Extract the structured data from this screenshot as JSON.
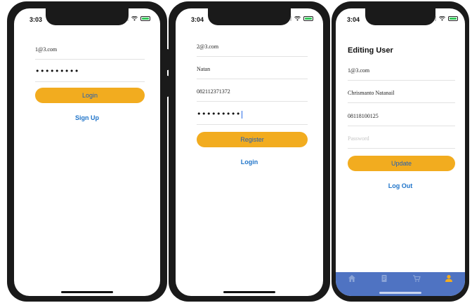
{
  "login_screen": {
    "status": {
      "time": "3:03"
    },
    "email_value": "1@3.com",
    "password_mask": "•••••••••",
    "login_button": "Login",
    "signup_link": "Sign Up"
  },
  "register_screen": {
    "status": {
      "time": "3:04"
    },
    "email_value": "2@3.com",
    "name_value": "Natan",
    "phone_value": "082112371372",
    "password_mask": "•••••••••",
    "register_button": "Register",
    "login_link": "Login"
  },
  "edit_screen": {
    "status": {
      "time": "3:04"
    },
    "title": "Editing User",
    "email_value": "1@3.com",
    "name_value": "Chrismanto Natanail",
    "phone_value": "08118100125",
    "password_placeholder": "Password",
    "update_button": "Update",
    "logout_link": "Log Out",
    "tabs": [
      {
        "icon": "home-icon",
        "active": false
      },
      {
        "icon": "document-icon",
        "active": false
      },
      {
        "icon": "cart-icon",
        "active": false
      },
      {
        "icon": "user-icon",
        "active": true
      }
    ]
  },
  "colors": {
    "primary_button": "#f2ac1f",
    "button_text": "#1f5fb8",
    "link_text": "#1f74c9",
    "tab_bar": "#4f73c2",
    "battery": "#34c759"
  }
}
